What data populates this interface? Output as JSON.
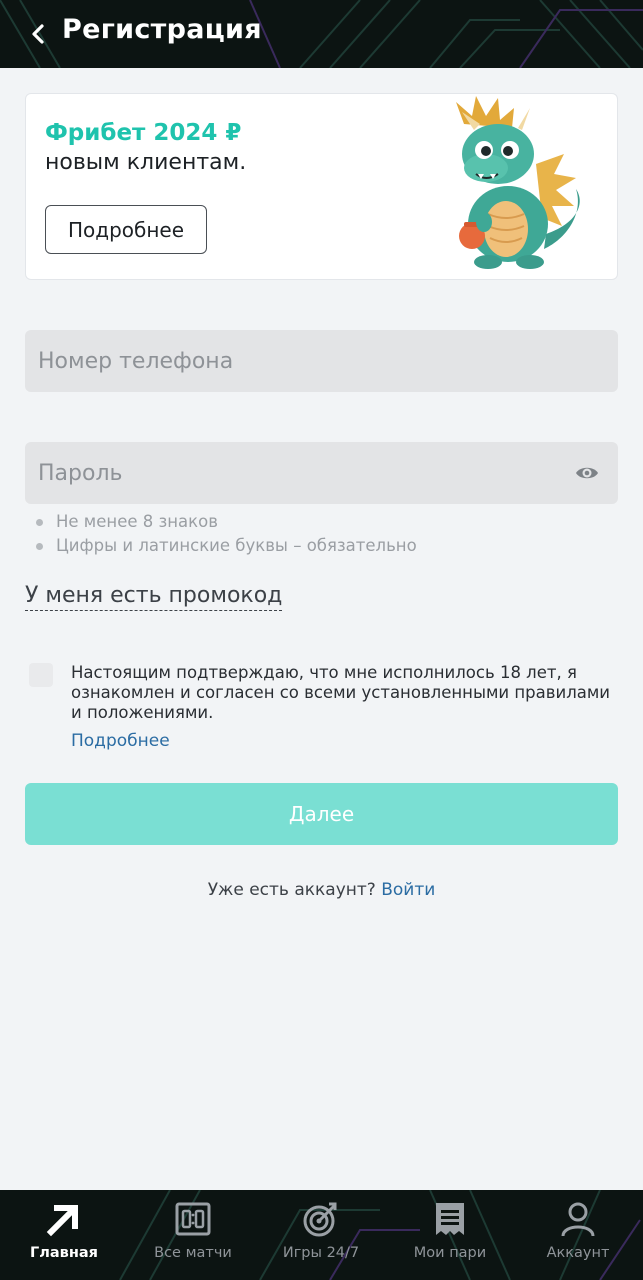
{
  "header": {
    "title": "Регистрация",
    "back_icon": "chevron-left-icon"
  },
  "promo": {
    "title": "Фрибет 2024 ₽",
    "subtitle": "новым клиентам.",
    "button_label": "Подробнее",
    "image": "dragon-mascot",
    "title_color": "#1fc3ad"
  },
  "form": {
    "phone_placeholder": "Номер телефона",
    "phone_value": "",
    "password_placeholder": "Пароль",
    "password_value": "",
    "password_toggle_icon": "eye-icon",
    "password_hints": [
      "Не менее 8 знаков",
      "Цифры и латинские буквы – обязательно"
    ],
    "promo_code_link": "У меня есть промокод",
    "consent_text": "Настоящим подтверждаю, что мне исполнилось 18 лет, я ознакомлен и согласен со всеми установленными правилами и положениями.",
    "consent_more_link": "Подробнее",
    "consent_checked": false,
    "submit_label": "Далее",
    "submit_color": "#7adfd3"
  },
  "login": {
    "prompt": "Уже есть аккаунт?",
    "link": "Войти"
  },
  "tabbar": {
    "items": [
      {
        "label": "Главная",
        "icon": "arrow-up-right-icon",
        "active": true
      },
      {
        "label": "Все матчи",
        "icon": "scoreboard-icon",
        "active": false
      },
      {
        "label": "Игры 24/7",
        "icon": "target-icon",
        "active": false
      },
      {
        "label": "Мои пари",
        "icon": "receipt-icon",
        "active": false
      },
      {
        "label": "Аккаунт",
        "icon": "user-icon",
        "active": false
      }
    ]
  },
  "colors": {
    "accent": "#1fc3ad",
    "link": "#2b6ca3",
    "header_bg": "#0c1412",
    "page_bg": "#f2f4f6"
  }
}
